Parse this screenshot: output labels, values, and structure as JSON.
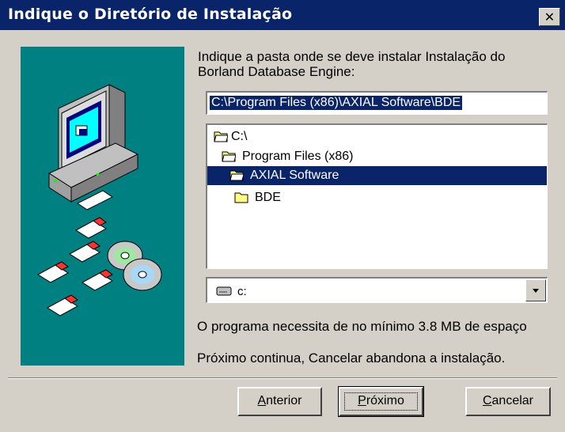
{
  "window": {
    "title": "Indique o Diretório de Instalação",
    "close_label": "✕"
  },
  "instructions": {
    "line1": "Indique a pasta onde se deve instalar Instalação do",
    "line2": "Borland Database Engine:"
  },
  "path_input": {
    "value": "C:\\Program Files (x86)\\AXIAL Software\\BDE"
  },
  "folder_tree": {
    "items": [
      {
        "label": "C:\\",
        "state": "open"
      },
      {
        "label": "Program Files (x86)",
        "state": "open"
      },
      {
        "label": "AXIAL Software",
        "state": "open",
        "selected": true
      },
      {
        "label": "BDE",
        "state": "closed"
      }
    ]
  },
  "drive_select": {
    "value": "c:",
    "icon": "drive-icon"
  },
  "notes": {
    "space": "O programa necessita de no mínimo 3.8 MB de espaço",
    "hint": "Próximo continua, Cancelar abandona a instalação."
  },
  "buttons": {
    "back": {
      "label": "Anterior",
      "mnemonic": "A",
      "rest": "nterior"
    },
    "next": {
      "label": "Próximo",
      "mnemonic": "P",
      "rest": "róximo"
    },
    "cancel": {
      "label": "Cancelar",
      "mnemonic": "C",
      "rest": "ancelar"
    }
  },
  "colors": {
    "titlebar": "#0a246a",
    "face": "#d4d0c8",
    "art_background": "#008080",
    "selection": "#0a246a"
  }
}
